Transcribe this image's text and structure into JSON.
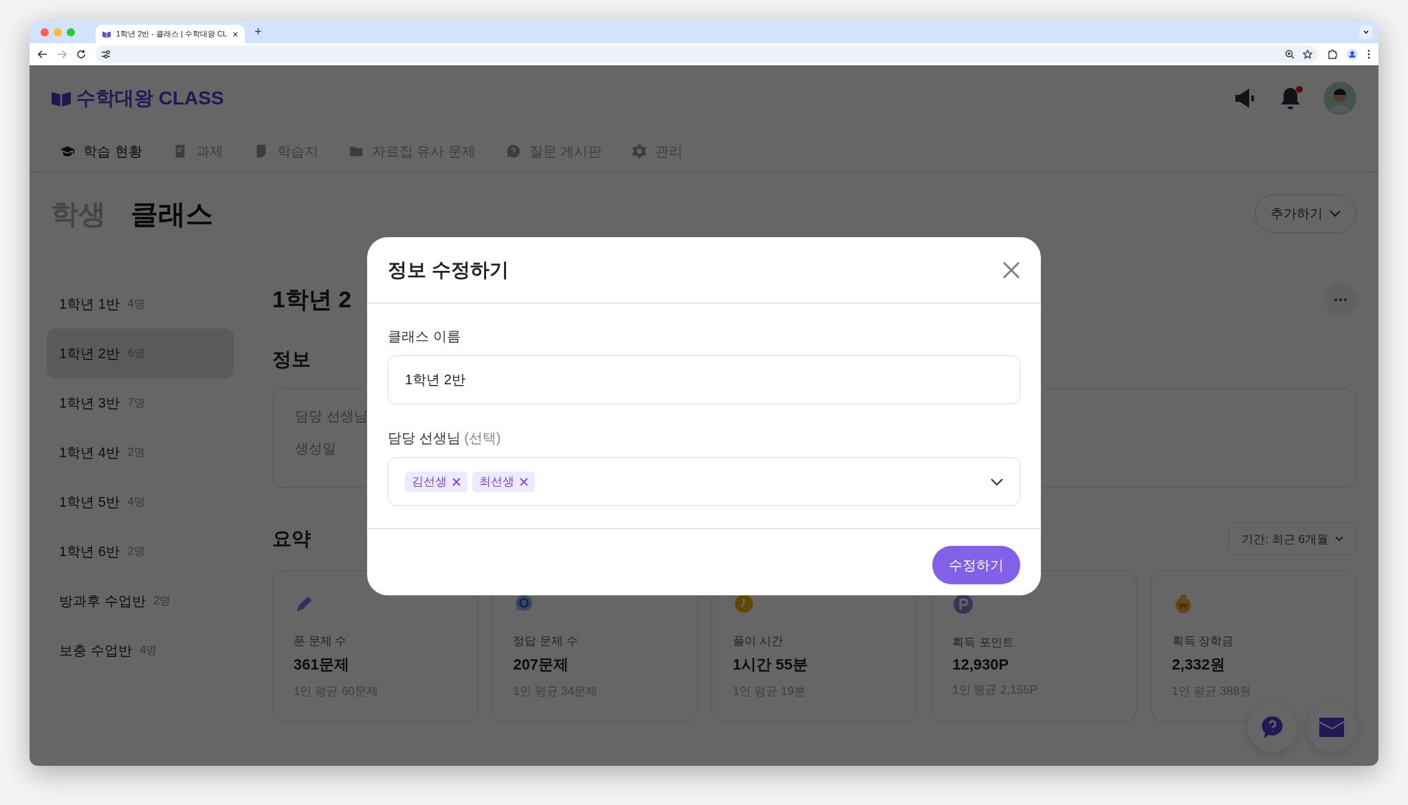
{
  "browser": {
    "tab_title": "1학년 2반 - 클래스 | 수학대왕 CL",
    "tab_close": "×",
    "new_tab": "+"
  },
  "header": {
    "logo_text": "수학대왕 CLASS",
    "bell_unread": true,
    "nav": [
      {
        "kind": "cap",
        "label": "학습 현황",
        "selected": true
      },
      {
        "kind": "assignment",
        "label": "과제",
        "selected": false
      },
      {
        "kind": "sheet",
        "label": "학습지",
        "selected": false
      },
      {
        "kind": "folder",
        "label": "자료집 유사 문제",
        "selected": false
      },
      {
        "kind": "question",
        "label": "질문 게시판",
        "selected": false
      },
      {
        "kind": "gear",
        "label": "관리",
        "selected": false
      }
    ]
  },
  "page_tabs": [
    {
      "label": "학생",
      "selected": false
    },
    {
      "label": "클래스",
      "selected": true
    }
  ],
  "add_button": "추가하기",
  "sidebar": {
    "items": [
      {
        "name": "1학년 1반",
        "count": "4명",
        "selected": false
      },
      {
        "name": "1학년 2반",
        "count": "6명",
        "selected": true
      },
      {
        "name": "1학년 3반",
        "count": "7명",
        "selected": false
      },
      {
        "name": "1학년 4반",
        "count": "2명",
        "selected": false
      },
      {
        "name": "1학년 5반",
        "count": "4명",
        "selected": false
      },
      {
        "name": "1학년 6반",
        "count": "2명",
        "selected": false
      },
      {
        "name": "방과후 수업반",
        "count": "2명",
        "selected": false
      },
      {
        "name": "보충 수업반",
        "count": "4명",
        "selected": false
      }
    ]
  },
  "content": {
    "title": "1학년 2",
    "info": {
      "heading": "정보",
      "fields": [
        "담당 선생님",
        "생성일"
      ]
    },
    "summary": {
      "heading": "요약",
      "period": "기간: 최근 6개월",
      "cards": [
        {
          "kind": "pencil",
          "label": "푼 문제 수",
          "value": "361문제",
          "average": "1인 평균 60문제"
        },
        {
          "kind": "chat",
          "label": "정답 문제 수",
          "value": "207문제",
          "average": "1인 평균 34문제"
        },
        {
          "kind": "clock",
          "label": "풀이 시간",
          "value": "1시간 55분",
          "average": "1인 평균 19분"
        },
        {
          "kind": "point",
          "label": "획득 포인트",
          "value": "12,930P",
          "average": "1인 평균 2,155P"
        },
        {
          "kind": "coin",
          "label": "획득 장학금",
          "value": "2,332원",
          "average": "1인 평균 388원"
        }
      ]
    }
  },
  "modal": {
    "title": "정보 수정하기",
    "name_label": "클래스 이름",
    "name_value": "1학년 2반",
    "teacher_label": "담당 선생님",
    "teacher_hint": "(선택)",
    "tags": [
      "김선생",
      "최선생"
    ],
    "submit": "수정하기"
  }
}
